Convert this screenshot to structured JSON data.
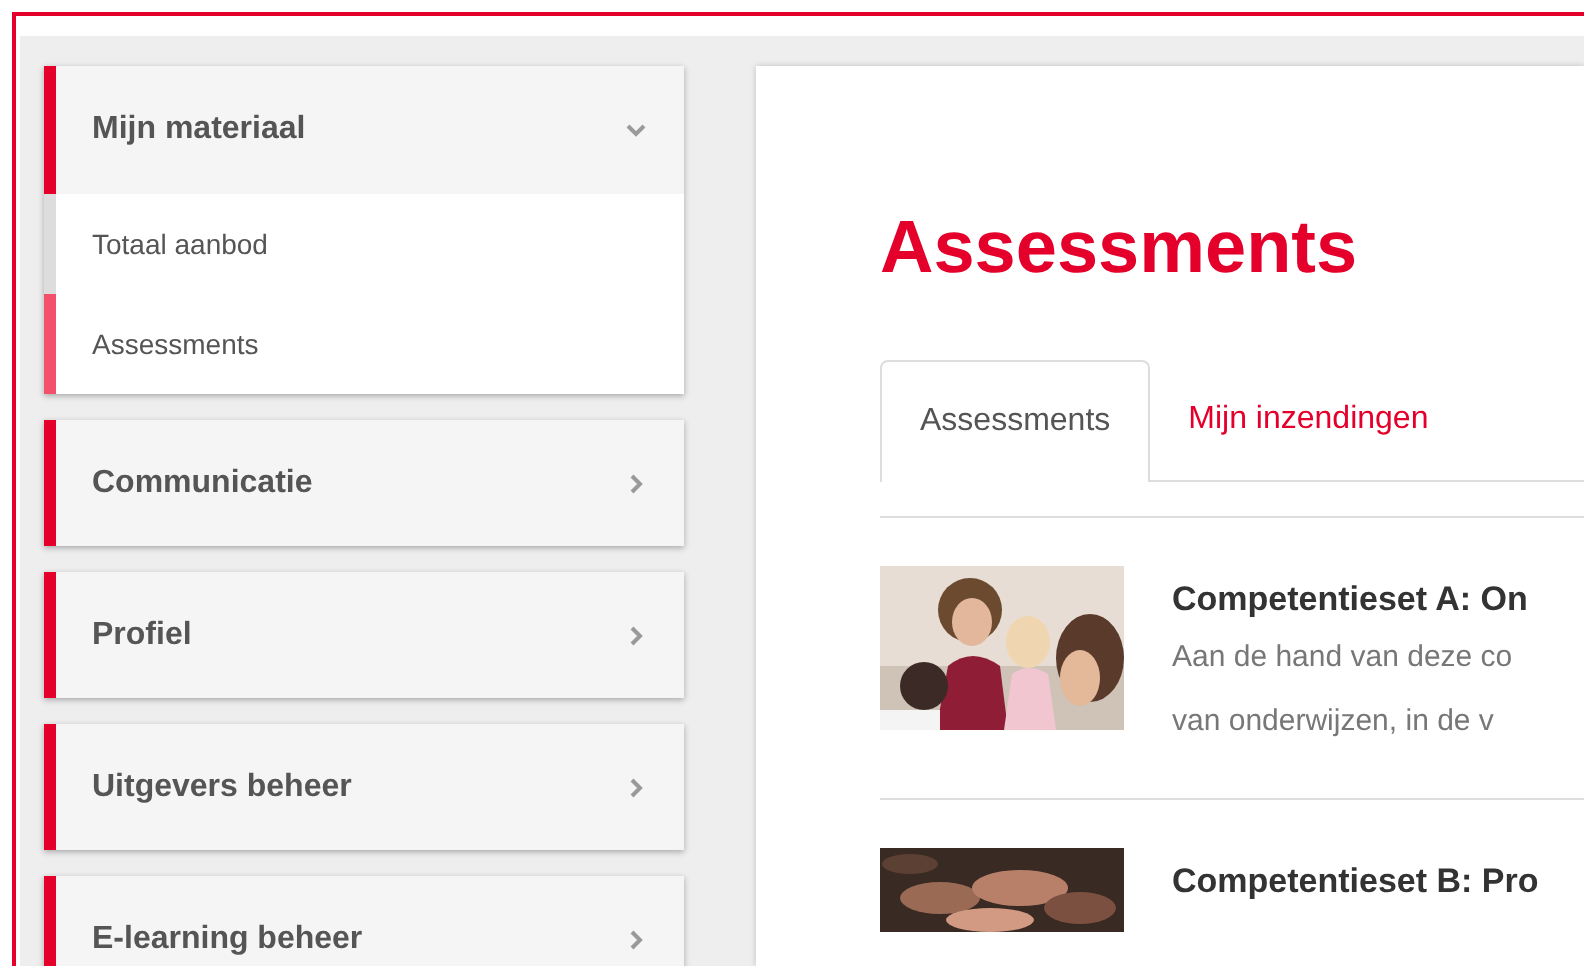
{
  "sidebar": {
    "items": [
      {
        "label": "Mijn materiaal",
        "expanded": true,
        "children": [
          {
            "label": "Totaal aanbod",
            "selected": false
          },
          {
            "label": "Assessments",
            "selected": true
          }
        ]
      },
      {
        "label": "Communicatie",
        "expanded": false
      },
      {
        "label": "Profiel",
        "expanded": false
      },
      {
        "label": "Uitgevers beheer",
        "expanded": false
      },
      {
        "label": "E-learning beheer",
        "expanded": false
      }
    ]
  },
  "main": {
    "title": "Assessments",
    "tabs": [
      {
        "label": "Assessments",
        "selected": true
      },
      {
        "label": "Mijn inzendingen",
        "selected": false
      }
    ],
    "items": [
      {
        "title": "Competentieset A: On",
        "description": [
          "Aan de hand van deze co",
          "van onderwijzen, in de v"
        ]
      },
      {
        "title": "Competentieset B: Pro"
      }
    ]
  }
}
